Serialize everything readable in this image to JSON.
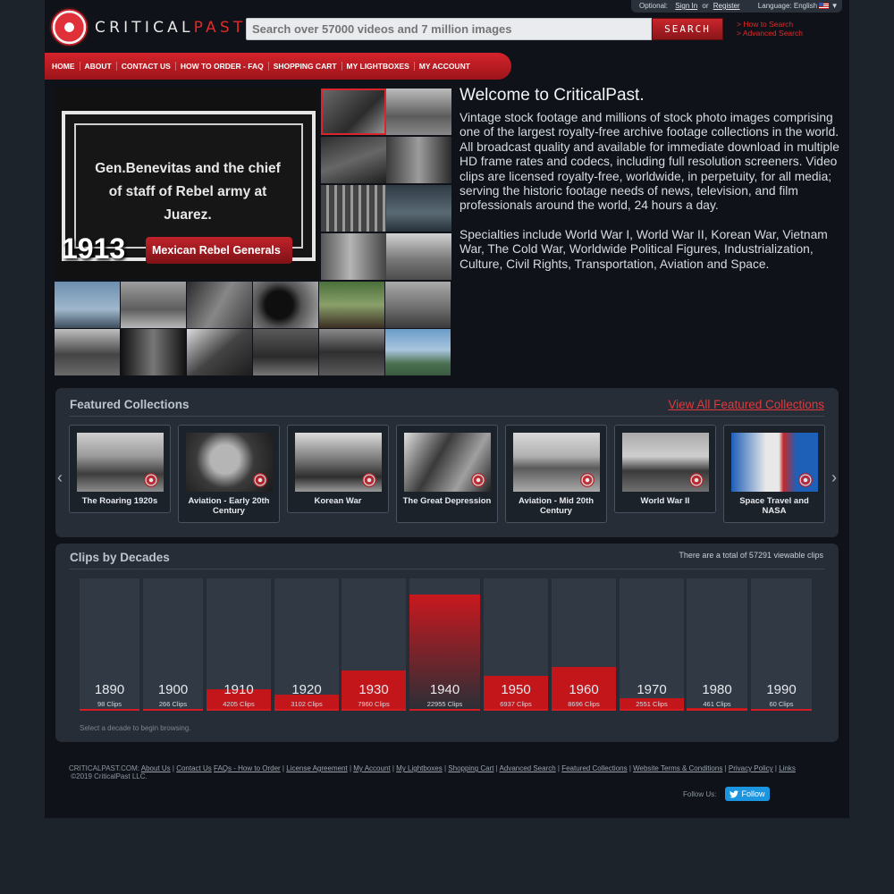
{
  "topbar": {
    "optional_label": "Optional:",
    "sign_in": "Sign In",
    "or": "or",
    "register": "Register",
    "language_label": "Language:",
    "language_value": "English",
    "caret": "▼"
  },
  "logo": {
    "brand_left": "CRITICAL",
    "brand_right": "PAST",
    "dot": "."
  },
  "search": {
    "placeholder": "Search over 57000 videos and 7 million images",
    "button_label": "SEARCH",
    "how_to": "> How to Search",
    "advanced": "> Advanced Search"
  },
  "nav": {
    "items": [
      "HOME",
      "ABOUT",
      "CONTACT US",
      "HOW TO ORDER - FAQ",
      "SHOPPING CART",
      "MY LIGHTBOXES",
      "MY ACCOUNT"
    ]
  },
  "hero": {
    "caption": "Gen.Benevitas and the chief of staff of Rebel army at Juarez.",
    "year": "1913",
    "title": "Mexican Rebel Generals"
  },
  "welcome": {
    "heading": "Welcome to CriticalPast.",
    "paragraph1": "Vintage stock footage and millions of stock photo images comprising one of the largest royalty-free archive footage collections in the world. All broadcast quality and available for immediate download in multiple HD frame rates and codecs, including full resolution screeners. Video clips are licensed royalty-free, worldwide, in perpetuity, for all media; serving the historic footage needs of news, television, and film professionals around the world, 24 hours a day.",
    "paragraph2": "Specialties include World War I, World War II, Korean War, Vietnam War, The Cold War, Worldwide Political Figures, Industrialization, Culture, Civil Rights, Transportation, Aviation and Space."
  },
  "featured": {
    "title": "Featured Collections",
    "view_all": "View All Featured Collections",
    "prev_arrow": "‹",
    "next_arrow": "›",
    "collections": [
      {
        "label": "The Roaring 1920s"
      },
      {
        "label": "Aviation - Early 20th Century"
      },
      {
        "label": "Korean War"
      },
      {
        "label": "The Great Depression"
      },
      {
        "label": "Aviation - Mid 20th Century"
      },
      {
        "label": "World War II"
      },
      {
        "label": "Space Travel and NASA"
      }
    ]
  },
  "decades": {
    "title": "Clips by Decades",
    "total_text": "There are a total of 57291 viewable clips",
    "hint": "Select a decade to begin browsing.",
    "items": [
      {
        "year": "1890",
        "clips_label": "98 Clips",
        "clips": 98
      },
      {
        "year": "1900",
        "clips_label": "266 Clips",
        "clips": 266
      },
      {
        "year": "1910",
        "clips_label": "4205 Clips",
        "clips": 4205
      },
      {
        "year": "1920",
        "clips_label": "3102 Clips",
        "clips": 3102
      },
      {
        "year": "1930",
        "clips_label": "7960 Clips",
        "clips": 7960
      },
      {
        "year": "1940",
        "clips_label": "22955 Clips",
        "clips": 22955
      },
      {
        "year": "1950",
        "clips_label": "6937 Clips",
        "clips": 6937
      },
      {
        "year": "1960",
        "clips_label": "8696 Clips",
        "clips": 8696
      },
      {
        "year": "1970",
        "clips_label": "2551 Clips",
        "clips": 2551
      },
      {
        "year": "1980",
        "clips_label": "461 Clips",
        "clips": 461
      },
      {
        "year": "1990",
        "clips_label": "60 Clips",
        "clips": 60
      }
    ]
  },
  "footer": {
    "prefix": "CRITICALPAST.COM:",
    "links": [
      "About Us",
      "Contact Us",
      "FAQs - How to Order",
      "License Agreement",
      "My Account",
      "My Lightboxes",
      "Shopping Cart",
      "Advanced Search",
      "Featured Collections",
      "Website Terms & Conditions",
      "Privacy Policy",
      "Links"
    ],
    "copyright": "©2019 CriticalPast LLC.",
    "follow_label": "Follow Us:",
    "follow_button": "Follow"
  },
  "colors": {
    "accent": "#c3161b",
    "link_red": "#e0393c",
    "panel": "#262d36",
    "background": "#1d232b"
  }
}
